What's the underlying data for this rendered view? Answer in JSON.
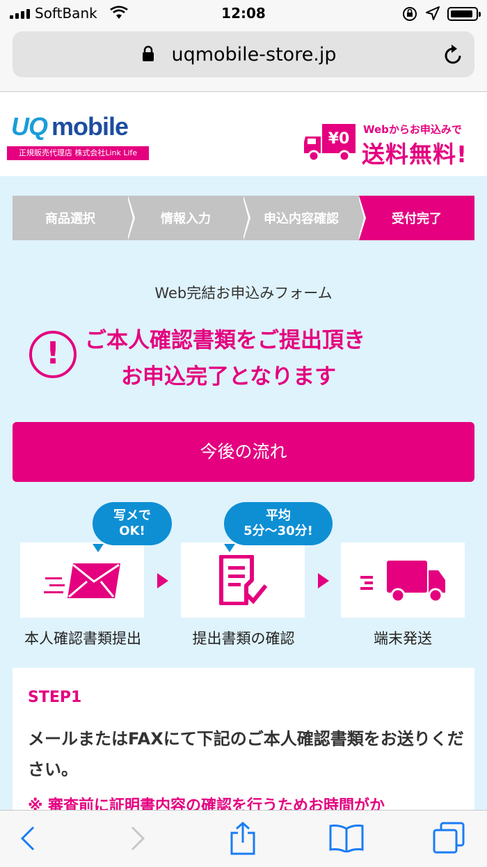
{
  "status_bar": {
    "carrier": "SoftBank",
    "time": "12:08"
  },
  "browser": {
    "url": "uqmobile-store.jp"
  },
  "header": {
    "logo_uq": "UQ",
    "logo_mobile": "mobile",
    "logo_sub": "正規販売代理店 株式会社Link Life",
    "promo_badge": "¥0",
    "promo_small": "Webからお申込みで",
    "promo_big": "送料無料!"
  },
  "steps": [
    {
      "label": "商品選択",
      "active": false
    },
    {
      "label": "情報入力",
      "active": false
    },
    {
      "label": "申込内容確認",
      "active": false
    },
    {
      "label": "受付完了",
      "active": true
    }
  ],
  "form": {
    "title": "Web完結お申込みフォーム",
    "alert_line1": "ご本人確認書類をご提出頂き",
    "alert_line2": "お申込完了となります",
    "flow_button": "今後の流れ"
  },
  "flow": {
    "bubble1": [
      "写メで",
      "OK!"
    ],
    "bubble2": [
      "平均",
      "5分〜30分!"
    ],
    "labels": [
      "本人確認書類提出",
      "提出書類の確認",
      "端末発送"
    ]
  },
  "step1": {
    "number": "STEP1",
    "text": "メールまたはFAXにて下記のご本人確認書類をお送りください。",
    "note": "※ 審査前に証明書内容の確認を行うためお時間がか"
  },
  "colors": {
    "accent": "#e4007f",
    "bubble": "#0e8fd4",
    "background": "#dff3fc"
  }
}
